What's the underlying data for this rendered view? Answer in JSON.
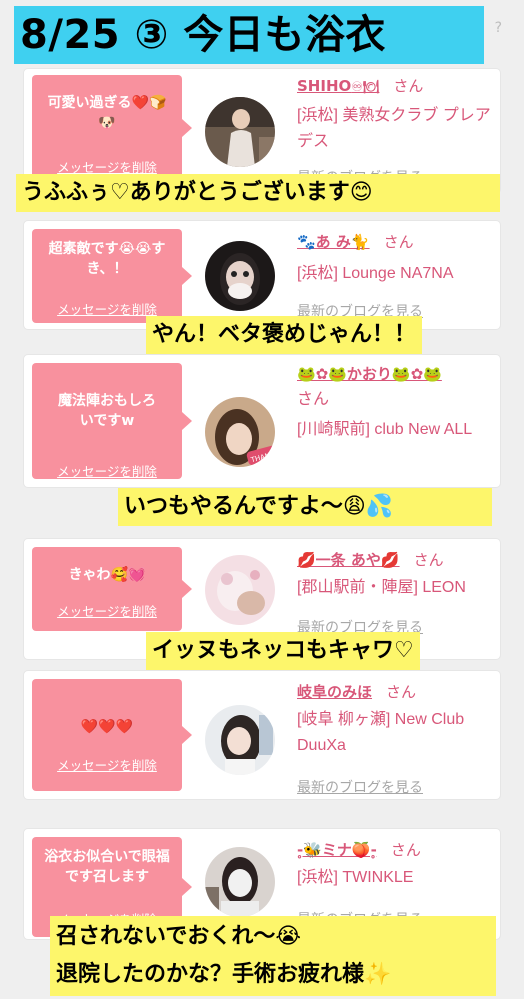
{
  "header": {
    "title": "8/25 ③ 今日も浴衣",
    "help_mark": "?"
  },
  "ui": {
    "delete_label": "メッセージを削除",
    "blog_label": "最新のブログを見る",
    "san": "さん"
  },
  "cards": [
    {
      "message": "可愛い過ぎる❤️🍞🐶",
      "girl_name": "SHIHO",
      "girl_name_suffix": "♾🍽",
      "shop": "[浜松] 美熟女クラブ プレアデス",
      "overlay": "うふふぅ♡ありがとうございます😊"
    },
    {
      "message": "超素敵です😭😭すき、！",
      "girl_name": "🐾あ み🐈",
      "shop": "[浜松] Lounge NA7NA",
      "overlay": "やん！ベタ褒めじゃん！！"
    },
    {
      "message": "魔法陣おもしろいですw",
      "girl_name": "🐸✿🐸かおり🐸✿🐸",
      "shop": "[川崎駅前] club New ALL",
      "avatar_text": "THANK",
      "overlay": "いつもやるんですよ〜😩💦"
    },
    {
      "message": "きゃわ🥰💓",
      "girl_name": "💋一条 あや💋",
      "shop": "[郡山駅前・陣屋] LEON",
      "overlay": "イッヌもネッコもキャワ♡"
    },
    {
      "message": "❤️❤️❤️",
      "girl_name": "岐阜のみほ",
      "shop": "[岐阜 柳ヶ瀬] New Club DuuXa"
    },
    {
      "message": "浴衣お似合いで眼福です召します",
      "girl_name": "‐̥🐝ミナ🍑‐̥",
      "shop": "[浜松] TWINKLE",
      "overlay_line1": "召されないでおくれ〜😭",
      "overlay_line2": "退院したのかな？手術お疲れ様✨"
    }
  ],
  "colors": {
    "title_bg": "#3fd0f0",
    "bubble_bg": "#f8919e",
    "name": "#d85779",
    "overlay_bg": "#fdf66b"
  }
}
